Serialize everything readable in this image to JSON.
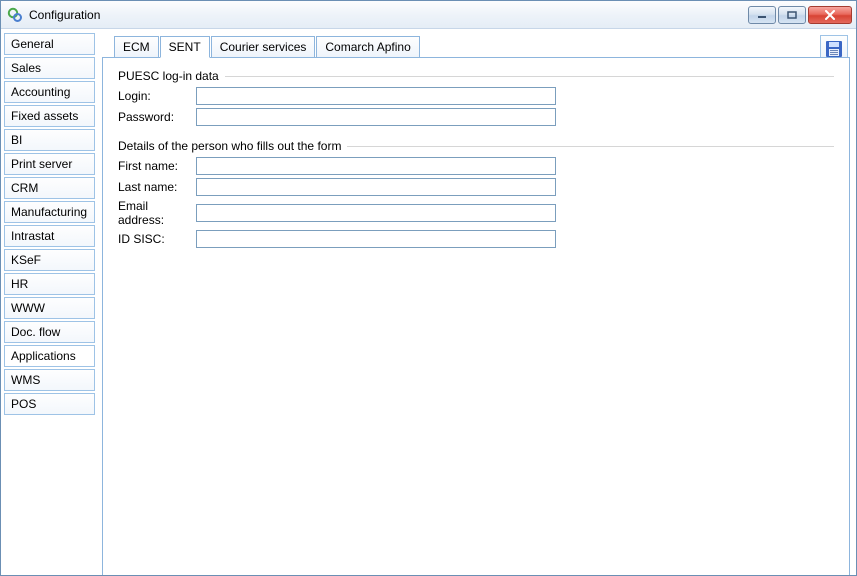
{
  "window": {
    "title": "Configuration"
  },
  "sidebar": {
    "items": [
      {
        "label": "General"
      },
      {
        "label": "Sales"
      },
      {
        "label": "Accounting"
      },
      {
        "label": "Fixed assets"
      },
      {
        "label": "BI"
      },
      {
        "label": "Print server"
      },
      {
        "label": "CRM"
      },
      {
        "label": "Manufacturing"
      },
      {
        "label": "Intrastat"
      },
      {
        "label": "KSeF"
      },
      {
        "label": "HR"
      },
      {
        "label": "WWW"
      },
      {
        "label": "Doc. flow"
      },
      {
        "label": "Applications"
      },
      {
        "label": "WMS"
      },
      {
        "label": "POS"
      }
    ],
    "active_index": 13
  },
  "tabs": {
    "items": [
      {
        "label": "ECM"
      },
      {
        "label": "SENT"
      },
      {
        "label": "Courier services"
      },
      {
        "label": "Comarch Apfino"
      }
    ],
    "active_index": 1
  },
  "groups": {
    "login": {
      "title": "PUESC log-in data",
      "login_label": "Login:",
      "login_value": "",
      "password_label": "Password:",
      "password_value": ""
    },
    "person": {
      "title": "Details of the person who fills out the form",
      "first_name_label": "First name:",
      "first_name_value": "",
      "last_name_label": "Last name:",
      "last_name_value": "",
      "email_label": "Email address:",
      "email_value": "",
      "sisc_label": "ID SISC:",
      "sisc_value": ""
    }
  }
}
